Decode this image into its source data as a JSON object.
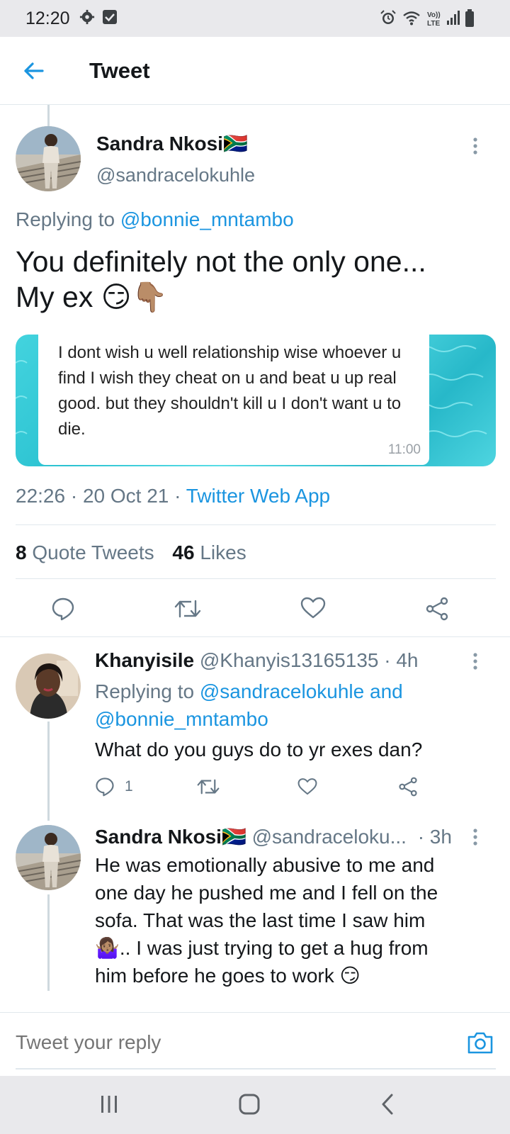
{
  "status_bar": {
    "time": "12:20"
  },
  "header": {
    "title": "Tweet"
  },
  "main_tweet": {
    "author_name": "Sandra Nkosi🇿🇦",
    "handle": "@sandracelokuhle",
    "replying_prefix": "Replying to",
    "replying_to": "@bonnie_mntambo",
    "text_line1": "You definitely not the only one...",
    "text_line2": "My ex 😏👇🏽",
    "image_text": "I dont wish u well relationship wise whoever u find I wish they cheat on u and beat u up real good. but they shouldn't kill u I don't want u to die.",
    "image_time": "11:00",
    "time": "22:26",
    "date": "20 Oct 21",
    "source": "Twitter Web App",
    "quote_count": "8",
    "quote_label": "Quote Tweets",
    "likes_count": "46",
    "likes_label": "Likes"
  },
  "replies": [
    {
      "author_name": "Khanyisile",
      "handle": "@Khanyis13165135",
      "age": "· 4h",
      "replying_prefix": "Replying to",
      "replying_to_line1": "@sandracelokuhle and",
      "replying_to_line2": "@bonnie_mntambo",
      "text": "What do you guys do to yr exes dan?",
      "reply_count": "1"
    },
    {
      "author_name": "Sandra Nkosi🇿🇦",
      "handle": "@sandraceloku...",
      "age": "· 3h",
      "text_line1": "He was emotionally abusive to me and",
      "text_line2": "one day he pushed me and I fell on the",
      "text_line3": "sofa. That was the last time I saw him",
      "text_line4": "🤷🏽‍♀️.. I was just trying to get a hug from",
      "text_line5": "him before he goes to work 😏"
    }
  ],
  "composer": {
    "placeholder": "Tweet your reply"
  },
  "colors": {
    "accent": "#1b95e0",
    "muted": "#657786",
    "divider": "#e1e8ed"
  }
}
